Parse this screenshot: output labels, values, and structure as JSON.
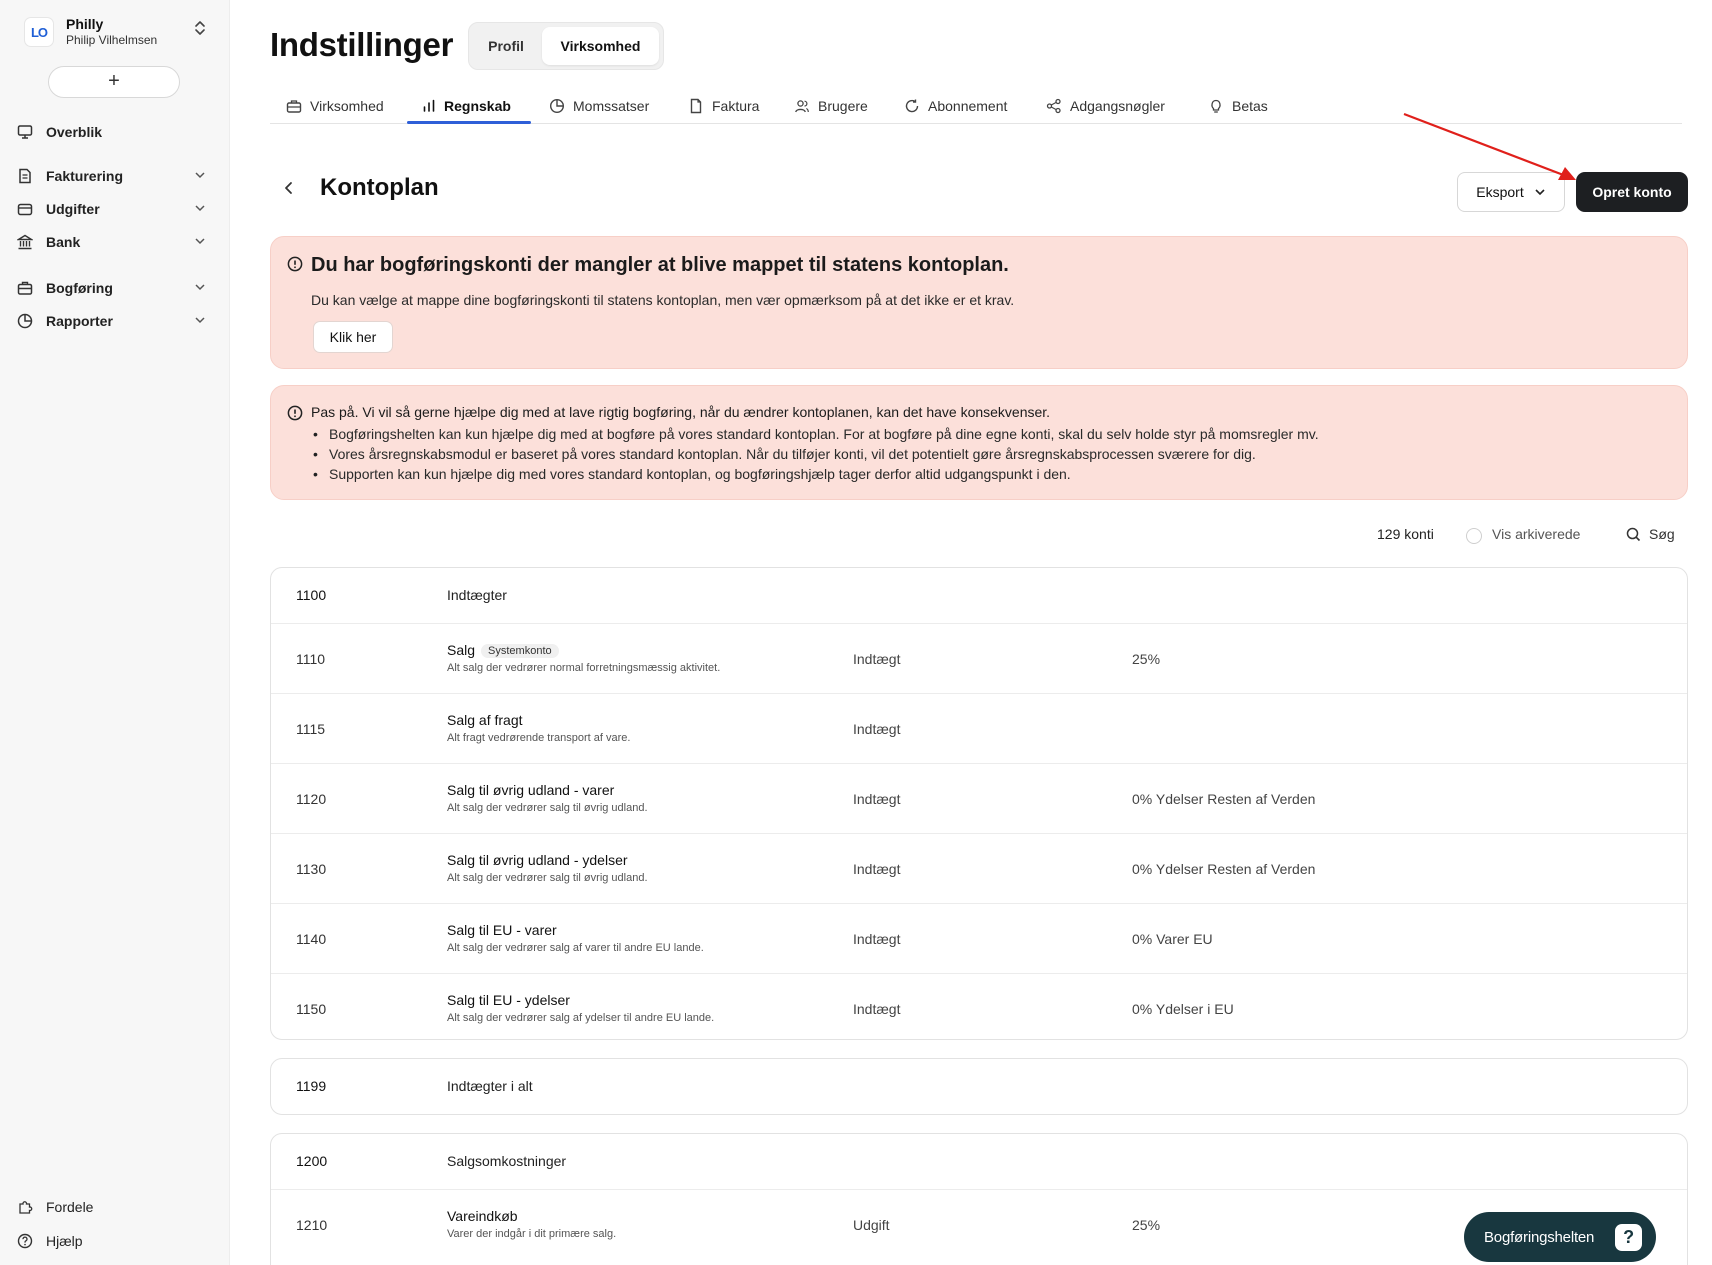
{
  "account": {
    "name": "Philly",
    "subtitle": "Philip Vilhelmsen",
    "logo_text": "LO"
  },
  "sidebar": {
    "new_button": "+",
    "items": [
      {
        "label": "Overblik",
        "icon": "monitor-icon"
      },
      {
        "label": "Fakturering",
        "icon": "invoice-icon"
      },
      {
        "label": "Udgifter",
        "icon": "wallet-icon"
      },
      {
        "label": "Bank",
        "icon": "bank-icon"
      },
      {
        "label": "Bogføring",
        "icon": "briefcase-icon"
      },
      {
        "label": "Rapporter",
        "icon": "pie-chart-icon"
      }
    ],
    "bottom": [
      {
        "label": "Fordele",
        "icon": "puzzle-icon"
      },
      {
        "label": "Hjælp",
        "icon": "help-circle-icon"
      }
    ]
  },
  "header": {
    "title": "Indstillinger",
    "segments": [
      "Profil",
      "Virksomhed"
    ],
    "active_segment": "Virksomhed"
  },
  "tabs": [
    {
      "label": "Virksomhed"
    },
    {
      "label": "Regnskab"
    },
    {
      "label": "Momssatser"
    },
    {
      "label": "Faktura"
    },
    {
      "label": "Brugere"
    },
    {
      "label": "Abonnement"
    },
    {
      "label": "Adgangsnøgler"
    },
    {
      "label": "Betas"
    }
  ],
  "active_tab": "Regnskab",
  "section": {
    "title": "Kontoplan",
    "export_label": "Eksport",
    "create_label": "Opret konto"
  },
  "alert_mapping": {
    "title": "Du har bogføringskonti der mangler at blive mappet til statens kontoplan.",
    "text": "Du kan vælge at mappe dine bogføringskonti til statens kontoplan, men vær opmærksom på at det ikke er et krav.",
    "button": "Klik her"
  },
  "alert_warning": {
    "title": "Pas på. Vi vil så gerne hjælpe dig med at lave rigtig bogføring, når du ændrer kontoplanen, kan det have konsekvenser.",
    "bullets": [
      "Bogføringshelten kan kun hjælpe dig med at bogføre på vores standard kontoplan. For at bogføre på dine egne konti, skal du selv holde styr på momsregler mv.",
      "Vores årsregnskabsmodul er baseret på vores standard kontoplan. Når du tilføjer konti, vil det potentielt gøre årsregnskabsprocessen sværere for dig.",
      "Supporten kan kun hjælpe dig med vores standard kontoplan, og bogføringshjælp tager derfor altid udgangspunkt i den."
    ]
  },
  "list_meta": {
    "count": "129 konti",
    "archived_label": "Vis arkiverede",
    "search_label": "Søg"
  },
  "accounts": {
    "group_1100": {
      "number": "1100",
      "name": "Indtægter"
    },
    "rows_1100": [
      {
        "number": "1110",
        "name": "Salg",
        "badge": "Systemkonto",
        "desc": "Alt salg der vedrører normal forretningsmæssig aktivitet.",
        "type": "Indtægt",
        "vat": "25%"
      },
      {
        "number": "1115",
        "name": "Salg af fragt",
        "badge": "",
        "desc": "Alt fragt vedrørende transport af vare.",
        "type": "Indtægt",
        "vat": ""
      },
      {
        "number": "1120",
        "name": "Salg til øvrig udland - varer",
        "badge": "",
        "desc": "Alt salg der vedrører salg til øvrig udland.",
        "type": "Indtægt",
        "vat": "0% Ydelser Resten af Verden"
      },
      {
        "number": "1130",
        "name": "Salg til øvrig udland - ydelser",
        "badge": "",
        "desc": "Alt salg der vedrører salg til øvrig udland.",
        "type": "Indtægt",
        "vat": "0% Ydelser Resten af Verden"
      },
      {
        "number": "1140",
        "name": "Salg til EU - varer",
        "badge": "",
        "desc": "Alt salg der vedrører salg af varer til andre EU lande.",
        "type": "Indtægt",
        "vat": "0% Varer EU"
      },
      {
        "number": "1150",
        "name": "Salg til EU - ydelser",
        "badge": "",
        "desc": "Alt salg der vedrører salg af ydelser til andre EU lande.",
        "type": "Indtægt",
        "vat": "0% Ydelser i EU"
      }
    ],
    "total_1199": {
      "number": "1199",
      "name": "Indtægter i alt"
    },
    "group_1200": {
      "number": "1200",
      "name": "Salgsomkostninger"
    },
    "rows_1200": [
      {
        "number": "1210",
        "name": "Vareindkøb",
        "badge": "",
        "desc": "Varer der indgår i dit primære salg.",
        "type": "Udgift",
        "vat": "25%"
      }
    ]
  },
  "help_button": {
    "label": "Bogføringshelten",
    "icon_text": "?"
  },
  "colors": {
    "accent": "#2e5fd8",
    "primary_button": "#1d1f22",
    "alert_bg": "#fce0da",
    "help_bg": "#18373f",
    "annotation_arrow": "#e0201b"
  }
}
